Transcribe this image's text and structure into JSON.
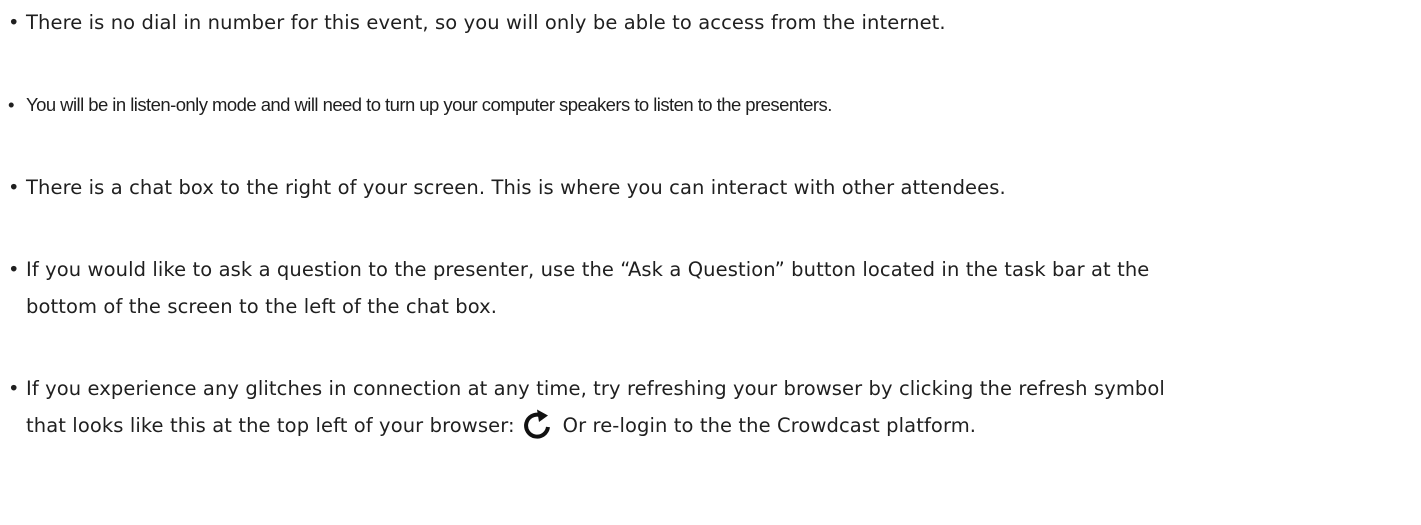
{
  "bullet_symbol": "•",
  "items": [
    {
      "text": "There is no dial in number for this event, so you will only be able to access from the internet."
    },
    {
      "text": "You will be in listen-only mode and will need to turn up your computer speakers to listen to the presenters."
    },
    {
      "text": "There is a chat box to the right of your screen. This is where you can interact with other attendees."
    },
    {
      "line1": "If you would like to ask a question to the presenter, use the “Ask a Question” button located in the task bar at the",
      "line2": "bottom of the screen to the left of the chat box."
    },
    {
      "line1": "If you experience any glitches in connection at any time, try refreshing your browser by clicking the refresh symbol",
      "line2_before_icon": "that looks like this at the top left of your browser:",
      "icon": "refresh-icon",
      "line2_after_icon": "Or re-login to the the Crowdcast platform."
    }
  ]
}
